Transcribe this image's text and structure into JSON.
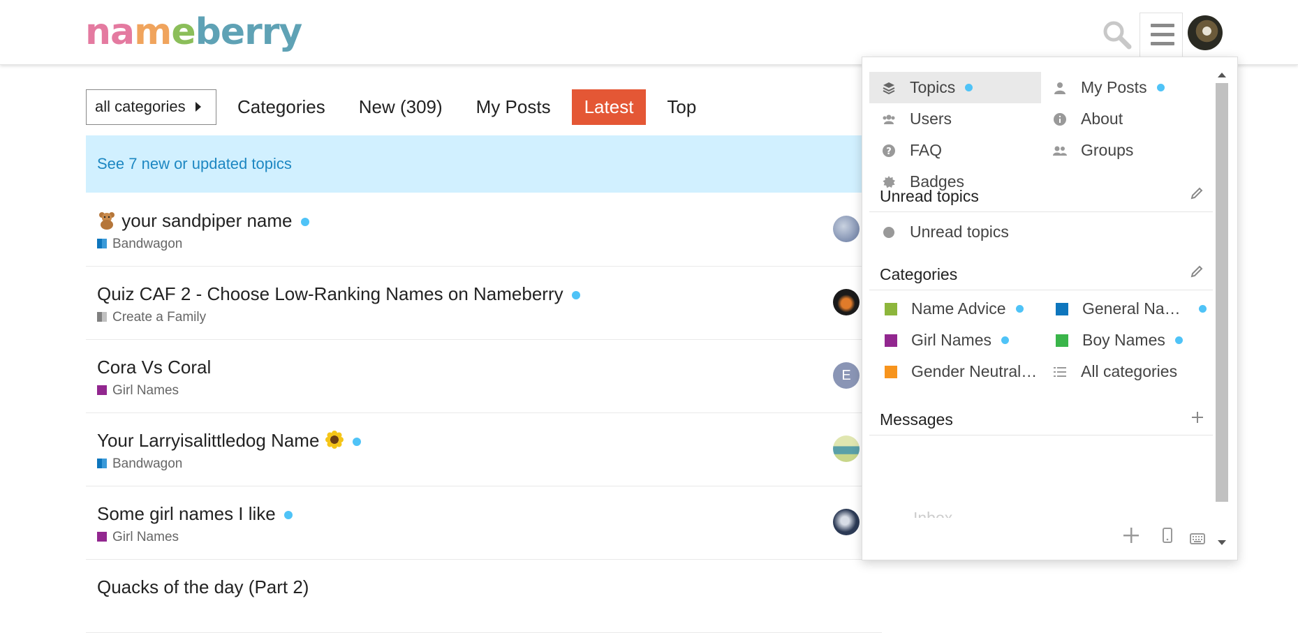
{
  "brand": {
    "letters": [
      "n",
      "a",
      "m",
      "e",
      "b",
      "e",
      "r",
      "r",
      "y"
    ],
    "colors": [
      "#e47aa0",
      "#e47aa0",
      "#f0a45d",
      "#8bbe5a",
      "#5fa2b5",
      "#5fa2b5",
      "#5fa2b5",
      "#5fa2b5",
      "#5fa2b5"
    ]
  },
  "nav": {
    "category_dropdown": "all categories",
    "links": [
      "Categories",
      "New (309)",
      "My Posts",
      "Latest",
      "Top"
    ],
    "active": "Latest"
  },
  "banner": {
    "text": "See 7 new or updated topics"
  },
  "topics": [
    {
      "title": "your sandpiper name",
      "emoji": "teddy-bear",
      "unread": true,
      "category": "Bandwagon",
      "category_color": "#0e76bd"
    },
    {
      "title": "Quiz CAF 2 - Choose Low-Ranking Names on Nameberry",
      "unread": true,
      "category": "Create a Family",
      "category_color": "#808080"
    },
    {
      "title": "Cora Vs Coral",
      "unread": false,
      "category": "Girl Names",
      "category_color": "#92278f"
    },
    {
      "title": "Your Larryisalittledog Name",
      "emoji_after": "sunflower",
      "unread": true,
      "category": "Bandwagon",
      "category_color": "#0e76bd"
    },
    {
      "title": "Some girl names I like",
      "unread": true,
      "category": "Girl Names",
      "category_color": "#92278f"
    },
    {
      "title": "Quacks of the day (Part 2)",
      "unread": false,
      "category": "",
      "category_color": ""
    }
  ],
  "topic_avatars": [
    {
      "letter": "",
      "colors": [
        "#7f8fb0",
        "#c9d2e0"
      ]
    },
    {
      "letter": "",
      "colors": [
        "#e07b2a",
        "#1a1a1a"
      ]
    },
    {
      "letter": "E",
      "colors": [
        "#8a95b5",
        "#8a95b5"
      ]
    },
    {
      "letter": "",
      "colors": [
        "#5aa0a8",
        "#e0e6b0"
      ]
    },
    {
      "letter": "",
      "colors": [
        "#2c3a55",
        "#d8dde6"
      ]
    }
  ],
  "menu": {
    "links": [
      {
        "label": "Topics",
        "icon": "layers-icon",
        "dot": true,
        "selected": true
      },
      {
        "label": "My Posts",
        "icon": "user-icon",
        "dot": true
      },
      {
        "label": "Users",
        "icon": "users-icon",
        "dot": false
      },
      {
        "label": "About",
        "icon": "info-icon",
        "dot": false
      },
      {
        "label": "FAQ",
        "icon": "question-icon",
        "dot": false
      },
      {
        "label": "Groups",
        "icon": "groups-icon",
        "dot": false
      },
      {
        "label": "Badges",
        "icon": "badge-icon",
        "dot": false
      }
    ],
    "unread_section": {
      "title": "Unread topics",
      "item": "Unread topics"
    },
    "categories_section": {
      "title": "Categories",
      "items": [
        {
          "label": "Name Advice",
          "color": "#8db63c",
          "dot": true
        },
        {
          "label": "General Na…",
          "color": "#0e76bd",
          "dot": true
        },
        {
          "label": "Girl Names",
          "color": "#92278f",
          "dot": true
        },
        {
          "label": "Boy Names",
          "color": "#3ab54a",
          "dot": true
        },
        {
          "label": "Gender Neutral…",
          "color": "#f7941d",
          "dot": false
        },
        {
          "label": "All categories",
          "color": "",
          "dot": false
        }
      ]
    },
    "messages_section": {
      "title": "Messages",
      "item": "Inbox"
    }
  }
}
